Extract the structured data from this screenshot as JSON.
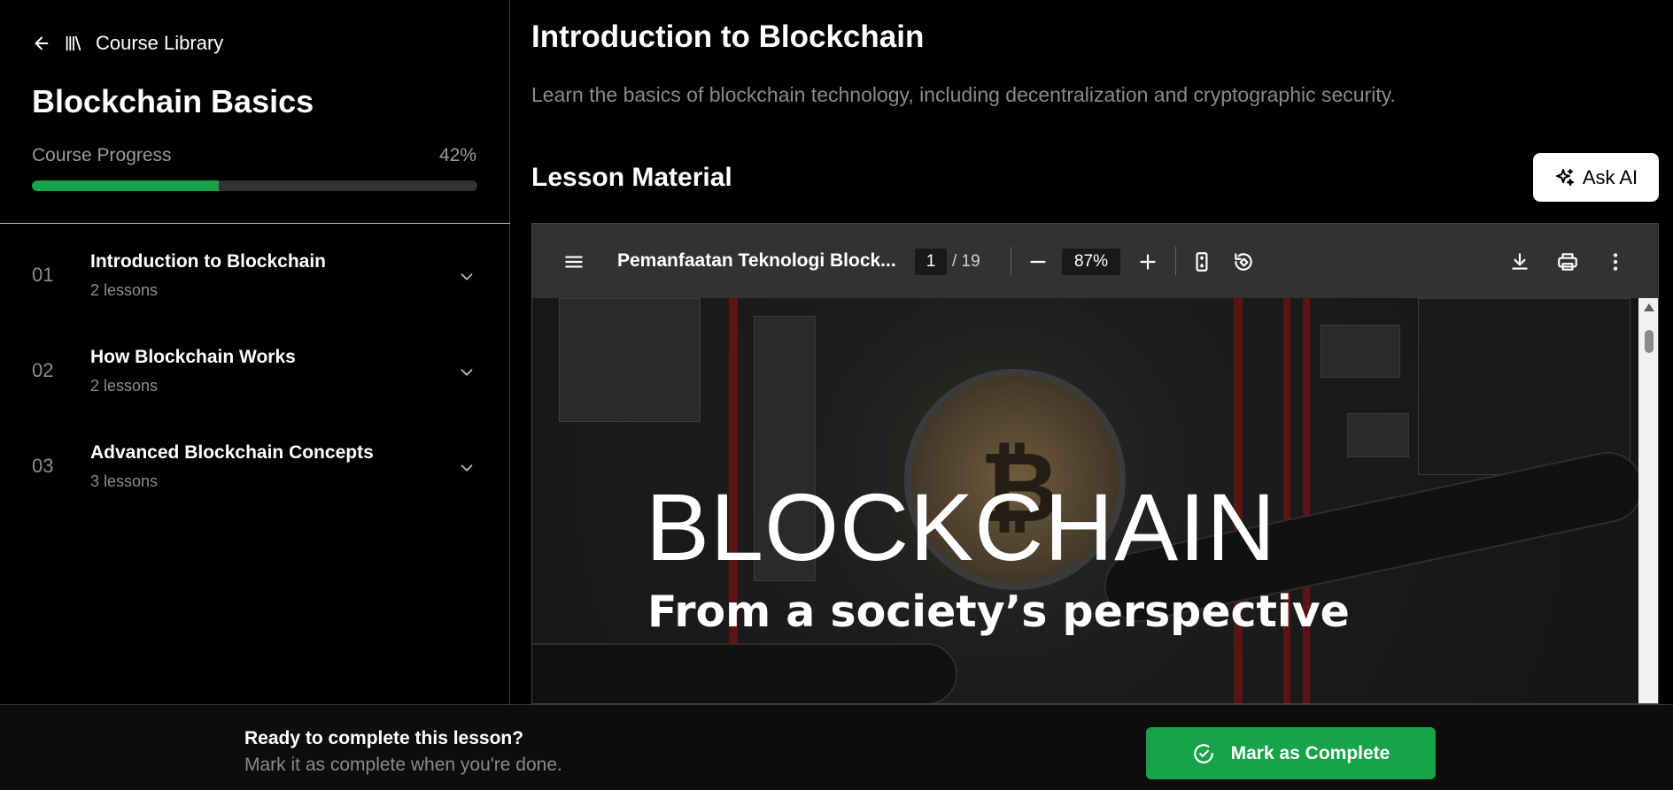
{
  "nav": {
    "back_label": "Course Library"
  },
  "course": {
    "title": "Blockchain Basics",
    "progress_label": "Course Progress",
    "progress_text": "42%",
    "progress_percent": 42
  },
  "modules": [
    {
      "num": "01",
      "title": "Introduction to Blockchain",
      "sub": "2 lessons"
    },
    {
      "num": "02",
      "title": "How Blockchain Works",
      "sub": "2 lessons"
    },
    {
      "num": "03",
      "title": "Advanced Blockchain Concepts",
      "sub": "3 lessons"
    }
  ],
  "lesson": {
    "title": "Introduction to Blockchain",
    "description": "Learn the basics of blockchain technology, including decentralization and cryptographic security.",
    "material_title": "Lesson Material",
    "ask_ai_label": "Ask AI"
  },
  "pdf": {
    "file_name": "Pemanfaatan Teknologi Block...",
    "page": "1",
    "total": "/ 19",
    "zoom": "87%",
    "slide_title": "BLOCKCHAIN",
    "slide_subtitle": "From a society’s perspective"
  },
  "footer": {
    "title": "Ready to complete this lesson?",
    "subtitle": "Mark it as complete when you're done.",
    "button_label": "Mark as Complete"
  },
  "colors": {
    "accent": "#16a34a",
    "background": "#000000",
    "muted": "#8a8a8a"
  },
  "icons": {
    "back": "arrow-left-icon",
    "library": "library-icon",
    "chevron": "chevron-down-icon",
    "sparkle": "sparkles-icon",
    "menu": "menu-icon",
    "minus": "minus-icon",
    "plus": "plus-icon",
    "fit": "fit-page-icon",
    "rotate": "rotate-icon",
    "download": "download-icon",
    "print": "print-icon",
    "more": "more-vertical-icon",
    "check": "check-circle-icon"
  }
}
